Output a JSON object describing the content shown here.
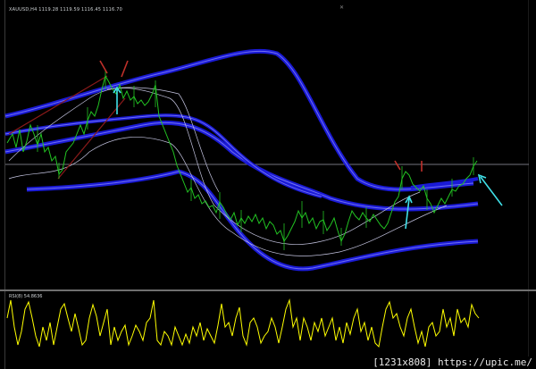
{
  "chart": {
    "title": "XAUUSD,H4  1119.28 1119.59 1116.45 1116.70",
    "symbol": "XAUUSD",
    "timeframe": "H4",
    "ohlc": [
      "1119.28",
      "1119.59",
      "1116.45",
      "1116.70"
    ]
  },
  "rsi": {
    "title": "RSI(8) 54.8636",
    "period": 8,
    "value": 54.8636
  },
  "footer": {
    "text": "[1231x808] https://upic.me/"
  },
  "colors": {
    "background": "#000000",
    "price": "#22c322",
    "band": "#1a1ad6",
    "band_glow": "#6a6af0",
    "envelope": "#c4c4e0",
    "trendline": "#8b1a1a",
    "arrow_red": "#c0302a",
    "arrow_cyan": "#40e0e8",
    "rsi_line": "#ffff00",
    "hline": "#9a9aa8"
  },
  "icons": [
    "close-icon"
  ]
}
